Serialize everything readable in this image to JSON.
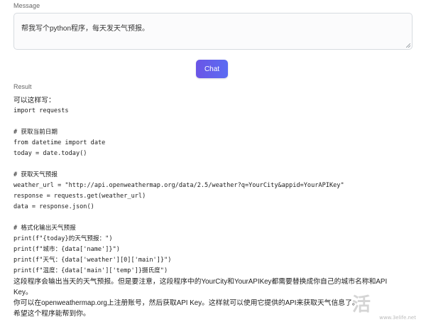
{
  "message": {
    "label": "Message",
    "value": "帮我写个python程序，每天发天气预报。"
  },
  "chat_button": {
    "label": "Chat",
    "color_start": "#6a55e6",
    "color_end": "#5b6cf2"
  },
  "result": {
    "label": "Result",
    "lines": [
      {
        "type": "text",
        "text": "可以这样写："
      },
      {
        "type": "code",
        "text": "import requests"
      },
      {
        "type": "code",
        "text": ""
      },
      {
        "type": "code",
        "text": "# 获取当前日期"
      },
      {
        "type": "code",
        "text": "from datetime import date"
      },
      {
        "type": "code",
        "text": "today = date.today()"
      },
      {
        "type": "code",
        "text": ""
      },
      {
        "type": "code",
        "text": "# 获取天气预报"
      },
      {
        "type": "code",
        "text": "weather_url = \"http://api.openweathermap.org/data/2.5/weather?q=YourCity&appid=YourAPIKey\""
      },
      {
        "type": "code",
        "text": "response = requests.get(weather_url)"
      },
      {
        "type": "code",
        "text": "data = response.json()"
      },
      {
        "type": "code",
        "text": ""
      },
      {
        "type": "code",
        "text": "# 格式化输出天气预报"
      },
      {
        "type": "code",
        "text": "print(f\"{today}的天气预报：\")"
      },
      {
        "type": "code",
        "text": "print(f\"城市：{data['name']}\")"
      },
      {
        "type": "code",
        "text": "print(f\"天气：{data['weather'][0]['main']}\")"
      },
      {
        "type": "code",
        "text": "print(f\"温度：{data['main']['temp']}摄氏度\")"
      },
      {
        "type": "text",
        "text": "这段程序会输出当天的天气预报。但是要注意，这段程序中的YourCity和YourAPIKey都需要替换成你自己的城市名称和API"
      },
      {
        "type": "text",
        "text": "Key。"
      },
      {
        "type": "text",
        "text": "你可以在openweathermap.org上注册账号，然后获取API Key。这样就可以使用它提供的API来获取天气信息了。"
      },
      {
        "type": "text",
        "text": "希望这个程序能帮到你。"
      }
    ]
  },
  "watermark": {
    "main": "三易生活",
    "sub": "www.3elife.net"
  }
}
